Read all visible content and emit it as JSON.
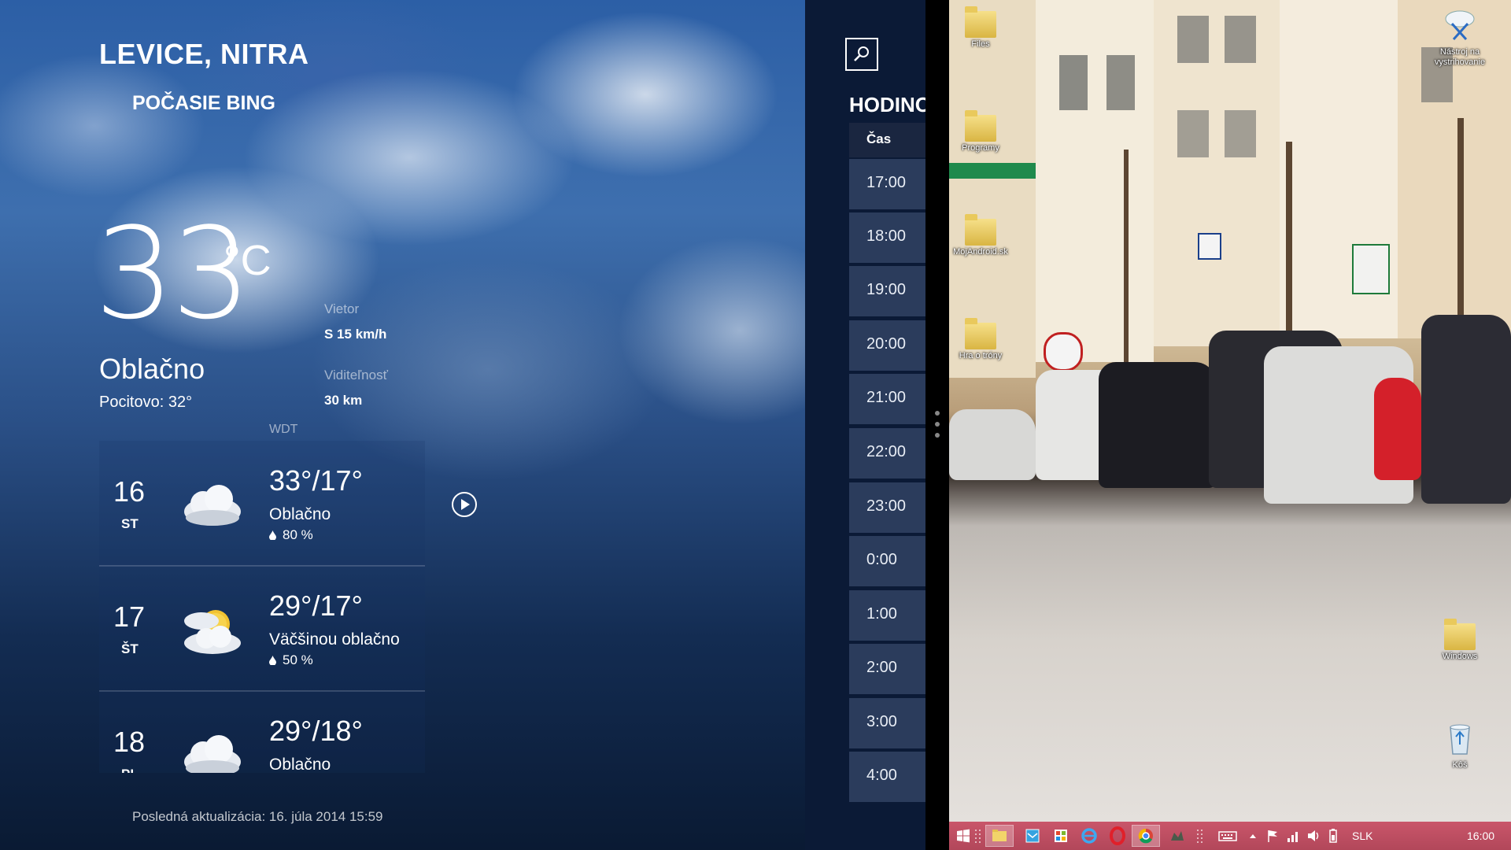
{
  "weather": {
    "location": "LEVICE, NITRA",
    "source": "POČASIE BING",
    "temperature": "33",
    "unit": "°C",
    "condition": "Oblačno",
    "feels_like": "Pocitovo: 32°",
    "wind_label": "Vietor",
    "wind_value": "S 15 km/h",
    "visibility_label": "Viditeľnosť",
    "visibility_value": "30 km",
    "provider": "WDT",
    "forecast": [
      {
        "day": "16",
        "weekday": "ST",
        "hilo": "33°/17°",
        "condition": "Oblačno",
        "precip": "80 %",
        "icon": "cloud-icon"
      },
      {
        "day": "17",
        "weekday": "ŠT",
        "hilo": "29°/17°",
        "condition": "Väčšinou oblačno",
        "precip": "50 %",
        "icon": "sun-cloud-icon"
      },
      {
        "day": "18",
        "weekday": "PI",
        "hilo": "29°/18°",
        "condition": "Oblačno",
        "precip": "",
        "icon": "cloud-icon"
      }
    ],
    "last_update": "Posledná aktualizácia: 16. júla 2014 15:59"
  },
  "clock": {
    "title": "HODINO",
    "column_header": "Čas",
    "hours": [
      "17:00",
      "18:00",
      "19:00",
      "20:00",
      "21:00",
      "22:00",
      "23:00",
      "0:00",
      "1:00",
      "2:00",
      "3:00",
      "4:00"
    ]
  },
  "desktop": {
    "icons_left": [
      "Files",
      "Programy",
      "MojAndroid.sk",
      "Hra o tróny"
    ],
    "icons_right": [
      "Nástroj na vystrihovanie",
      "Windows",
      "Kôš"
    ]
  },
  "taskbar": {
    "language": "SLK",
    "time": "16:00"
  },
  "colors": {
    "clock_panel": "#0b1a36",
    "clock_cell": "#2b3c5c",
    "taskbar": "#c9566a"
  }
}
